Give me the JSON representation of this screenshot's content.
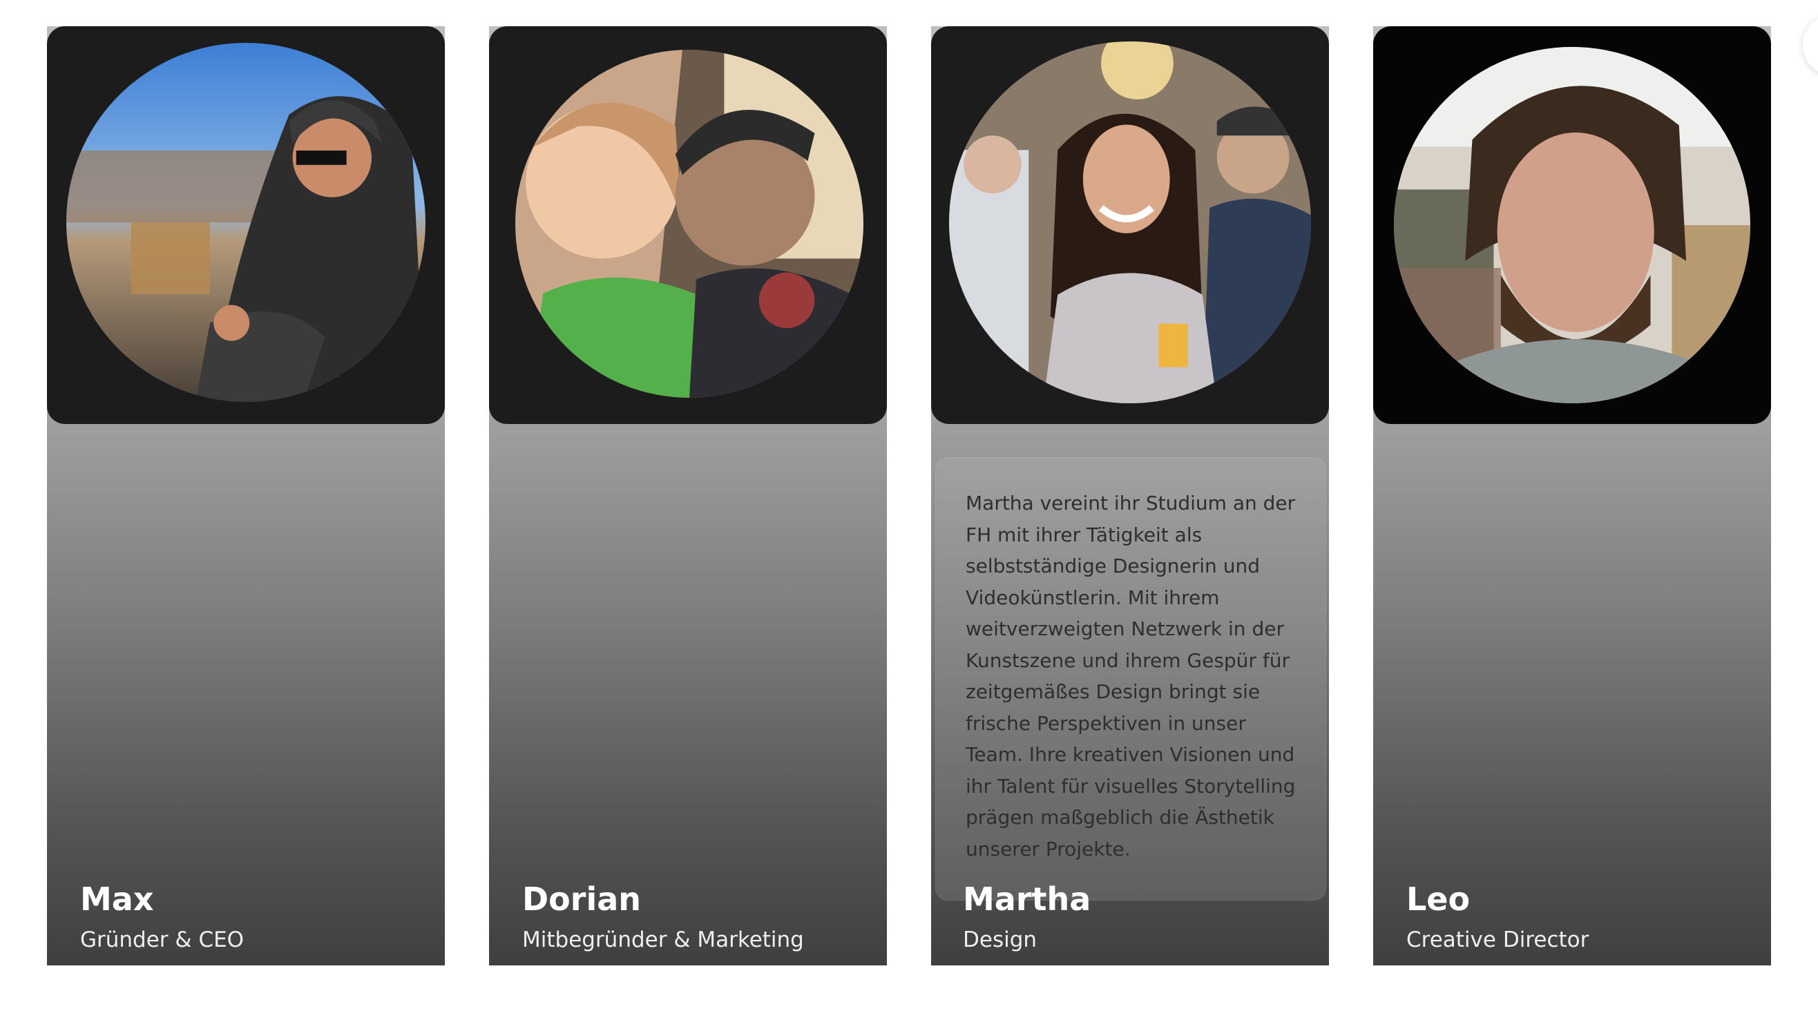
{
  "team": {
    "members": [
      {
        "name": "Max",
        "role": "Gründer & CEO",
        "photo": "portrait-photo"
      },
      {
        "name": "Dorian",
        "role": "Mitbegründer & Marketing",
        "photo": "portrait-photo"
      },
      {
        "name": "Martha",
        "role": "Design",
        "photo": "portrait-photo",
        "bio": "Martha vereint ihr Studium an der FH mit ihrer Tätigkeit als selbstständige Designerin und Videokünstlerin. Mit ihrem weitverzweigten Netzwerk in der Kunstszene und ihrem Gespür für zeitgemäßes Design bringt sie frische Perspektiven in unser Team. Ihre kreativen Visionen und ihr Talent für visuelles Storytelling prägen maßgeblich die Ästhetik unserer Projekte."
      },
      {
        "name": "Leo",
        "role": "Creative Director",
        "photo": "portrait-photo"
      }
    ]
  },
  "colors": {
    "photo_panel_bg": "#1c1c1c",
    "name_text": "#ffffff",
    "role_text": "#efefef",
    "bio_text": "#2e2e2e"
  }
}
